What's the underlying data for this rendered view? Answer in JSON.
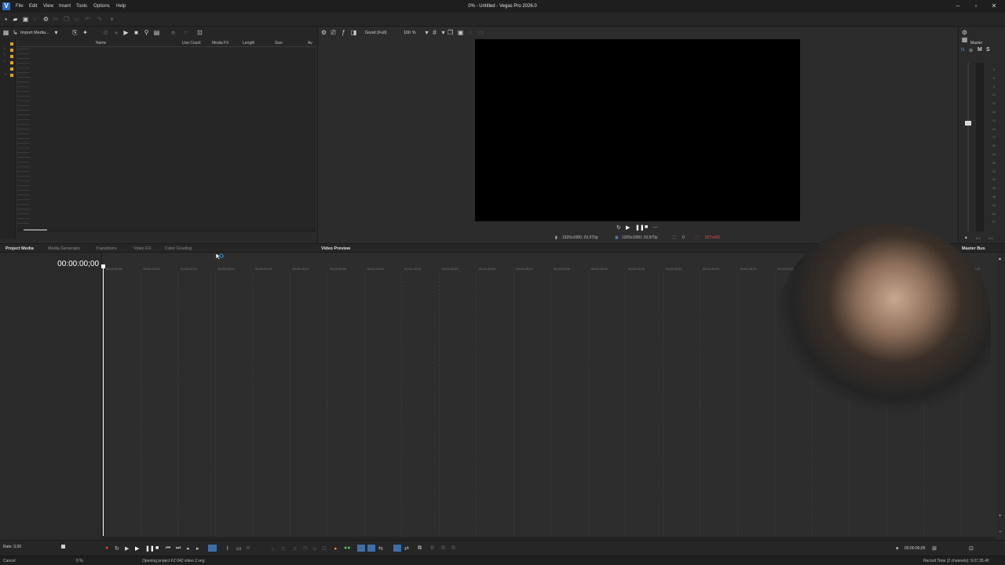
{
  "window": {
    "title": "0% - Untitled - Vegas Pro 2026.0",
    "controls": [
      "minimize-icon",
      "restore-icon",
      "close-icon"
    ]
  },
  "menu": {
    "items": [
      "File",
      "Edit",
      "View",
      "Insert",
      "Tools",
      "Options",
      "Help"
    ]
  },
  "media_pane": {
    "import_label": "Import Media...",
    "columns": [
      "Name",
      "Use Count",
      "Media FX",
      "Length",
      "Size",
      "Av"
    ]
  },
  "preview": {
    "quality": "Good (Full)",
    "zoom": "100 %",
    "project_info": "1920x1080; 29,970p",
    "preview_info": "1920x1080; 29,970p",
    "frame_number": "0",
    "display_info": "827x465"
  },
  "master": {
    "label": "Master",
    "bus_label": "Master Bus",
    "fx_label": "fx",
    "m_label": "M",
    "s_label": "S",
    "meter_scale": [
      "3",
      "6",
      "9",
      "12",
      "15",
      "18",
      "21",
      "24",
      "27",
      "30",
      "33",
      "36",
      "39",
      "42",
      "45",
      "48",
      "51",
      "54",
      "57"
    ],
    "bottom_left": "0.0",
    "bottom_right": "0.0"
  },
  "tabs": {
    "left": [
      "Project Media",
      "Media Generator",
      "Transitions",
      "Video FX",
      "Color Grading"
    ],
    "active_left": "Project Media",
    "right": "Video Preview"
  },
  "timeline": {
    "timecode": "00:00:00;00",
    "ruler": [
      "00:00:00;00",
      "00:00:10;00",
      "00:00:20;00",
      "00:00:29;29",
      "00:00:39;29",
      "00:00:49;29",
      "00:00:59;28",
      "00:01:09;28",
      "00:01:19;28",
      "00:01:29;29",
      "00:01:39;29",
      "00:01:49;29",
      "00:01:59;28",
      "00:02:09;28",
      "00:02:19;28",
      "00:02:29;29",
      "00:02:39;29",
      "00:02:49;29",
      "00:02:59;28",
      "00:03:09;28",
      "00:03:19;28",
      "00:03:29;29",
      "00:03:39;29",
      "00:03:49;29"
    ]
  },
  "bottom": {
    "rate": "Rate: 0,00",
    "end_timecode": "00:00:00;00"
  },
  "status": {
    "cancel": "Cancel",
    "progress": "0 %",
    "message": "Opening project FZ 042 video 2.veg",
    "record_time": "Record Time (2 channels): 9.07.35.40"
  }
}
